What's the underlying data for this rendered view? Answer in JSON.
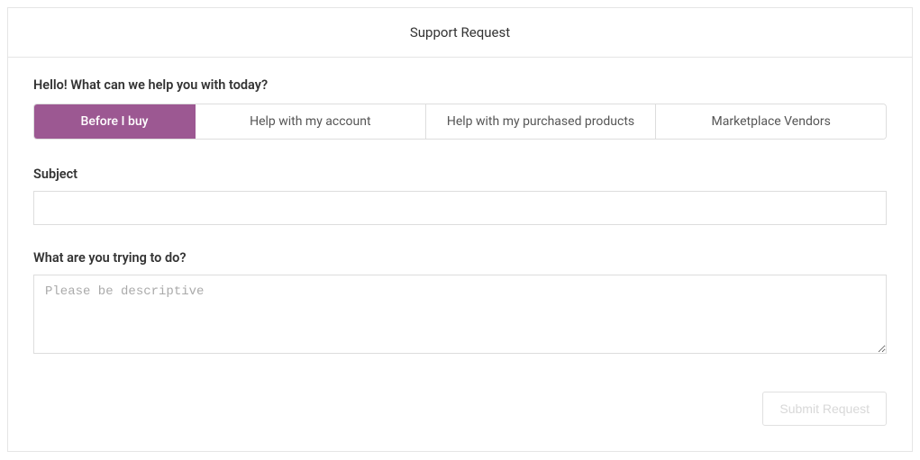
{
  "header": {
    "title": "Support Request"
  },
  "greeting": "Hello! What can we help you with today?",
  "tabs": [
    {
      "label": "Before I buy",
      "active": true
    },
    {
      "label": "Help with my account",
      "active": false
    },
    {
      "label": "Help with my purchased products",
      "active": false
    },
    {
      "label": "Marketplace Vendors",
      "active": false
    }
  ],
  "form": {
    "subject": {
      "label": "Subject",
      "value": ""
    },
    "description": {
      "label": "What are you trying to do?",
      "placeholder": "Please be descriptive",
      "value": ""
    }
  },
  "buttons": {
    "submit": "Submit Request"
  }
}
